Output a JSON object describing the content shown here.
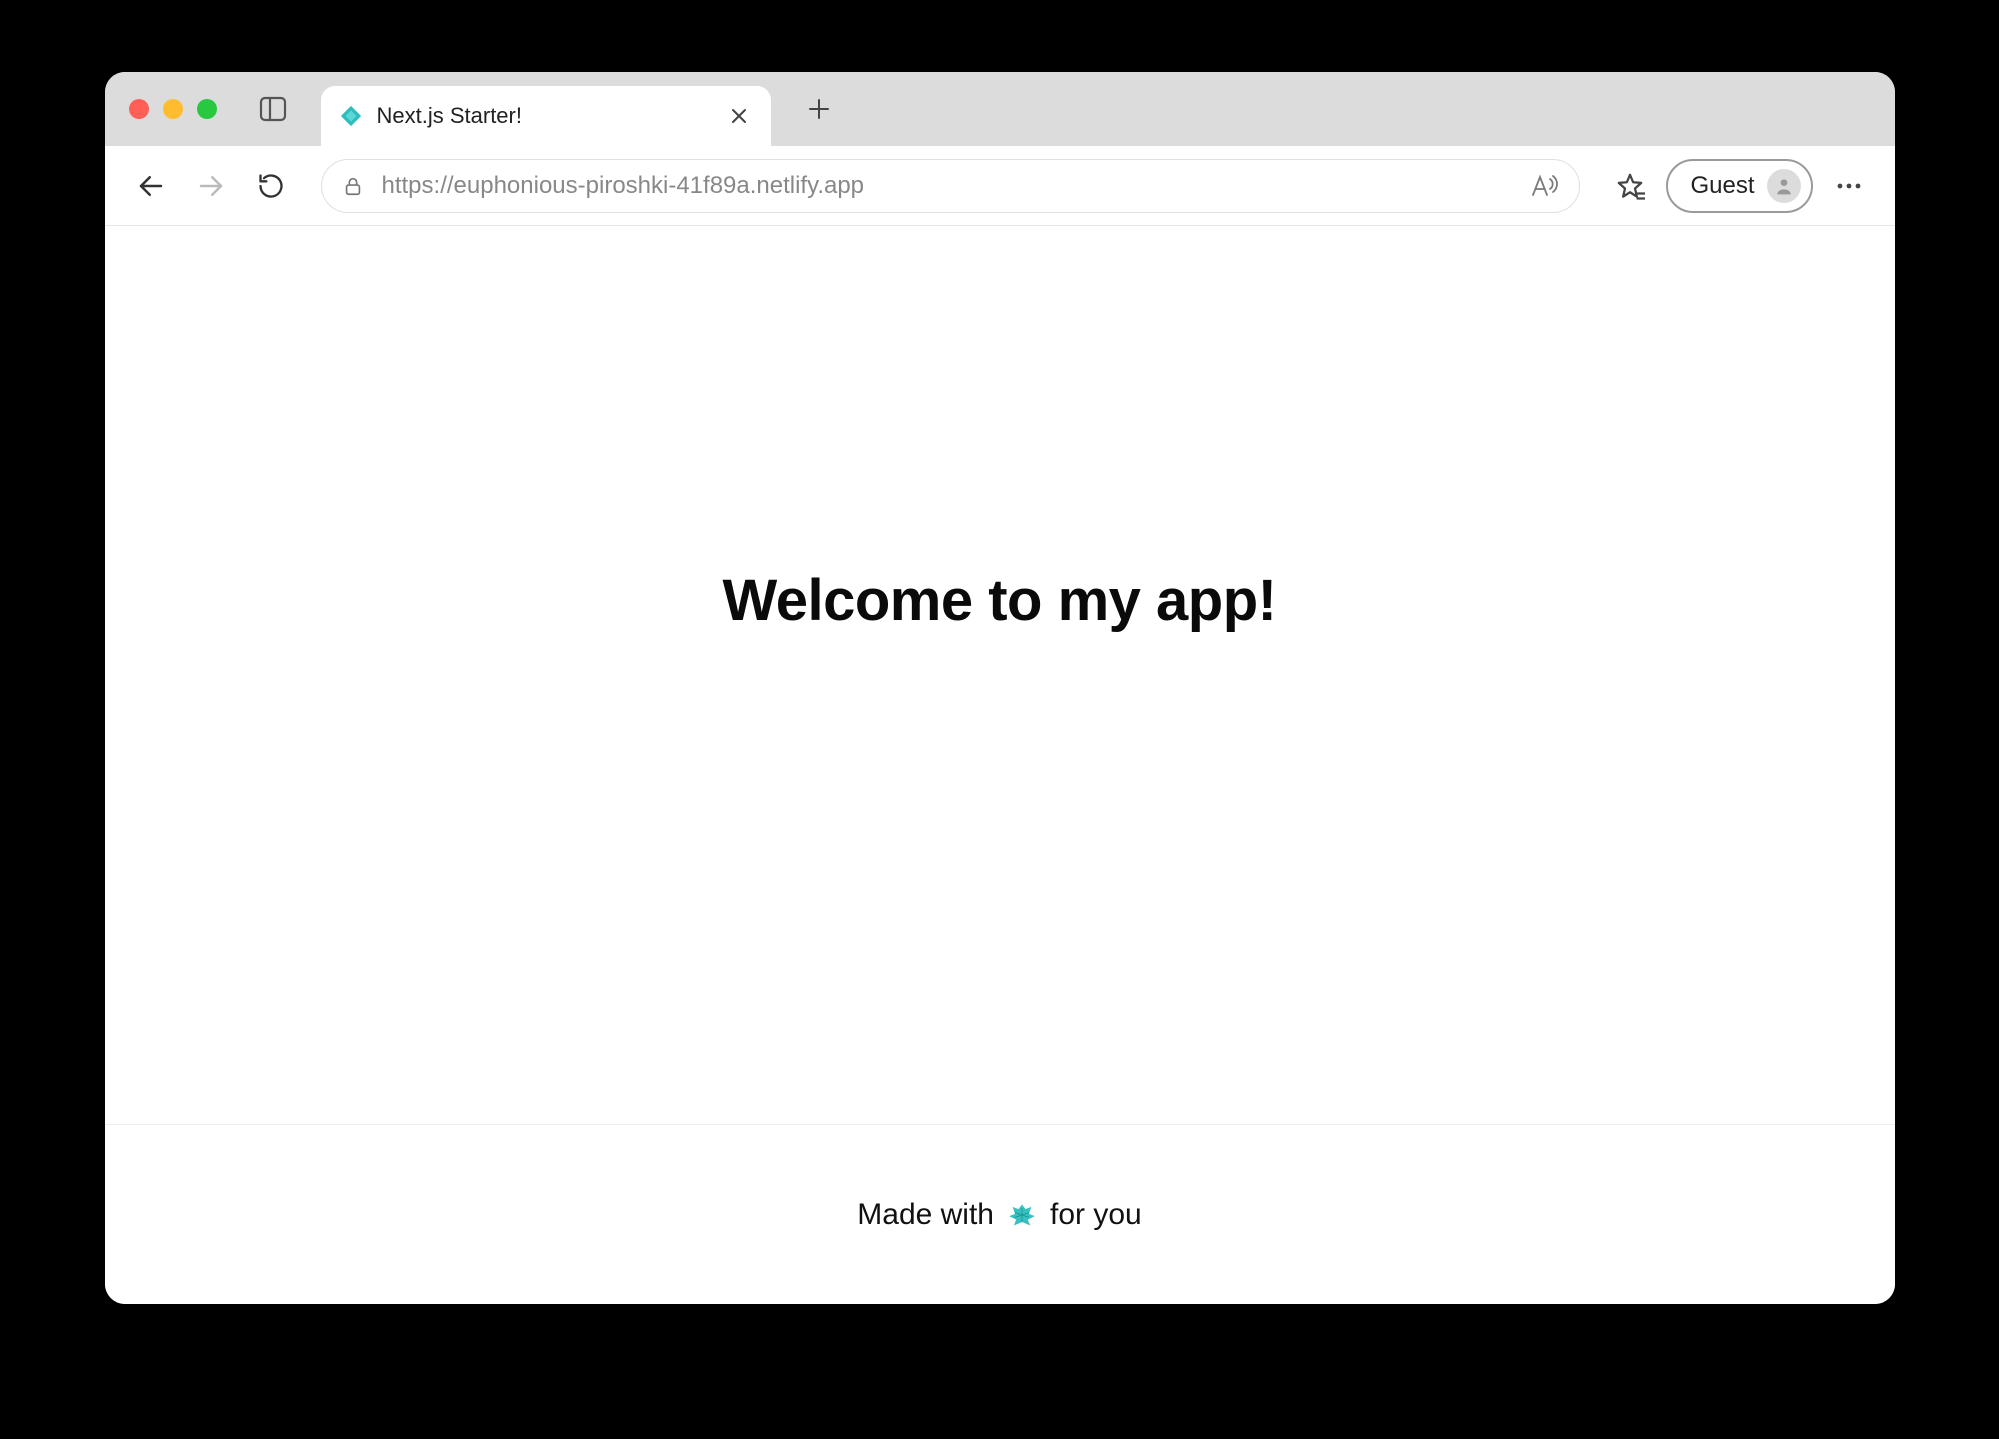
{
  "browser": {
    "tab": {
      "title": "Next.js Starter!",
      "favicon": "netlify-icon"
    },
    "toolbar": {
      "url": "https://euphonious-piroshki-41f89a.netlify.app",
      "profile_label": "Guest"
    }
  },
  "page": {
    "hero_title": "Welcome to my app!",
    "footer": {
      "prefix": "Made with",
      "suffix": "for you",
      "icon": "heart-icon",
      "icon_color": "#2ebdbd"
    }
  }
}
